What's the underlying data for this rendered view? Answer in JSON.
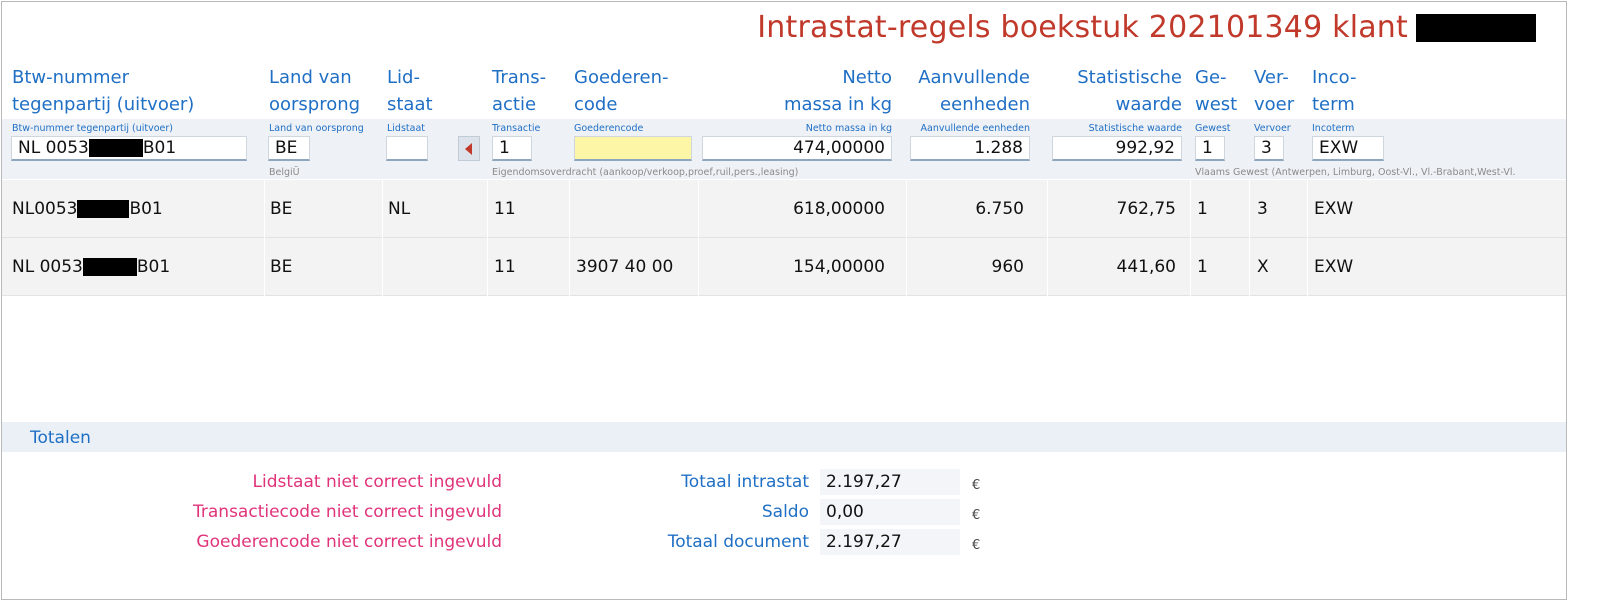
{
  "title": "Intrastat-regels boekstuk 202101349  klant",
  "headers": {
    "btw": "Btw-nummer\ntegenpartij (uitvoer)",
    "land": "Land van\noorsprong",
    "lid": "Lid-\nstaat",
    "trans": "Trans-\nactie",
    "goed": "Goederen-\ncode",
    "netto": "Netto\nmassa in kg",
    "aanv": "Aanvullende\neenheden",
    "stat": "Statistische\nwaarde",
    "gewest": "Ge-\nwest",
    "vervoer": "Ver-\nvoer",
    "inco": "Inco-\nterm"
  },
  "edit": {
    "labels": {
      "btw": "Btw-nummer tegenpartij (uitvoer)",
      "land": "Land van oorsprong",
      "lid": "Lidstaat",
      "trans": "Transactie",
      "goed": "Goederencode",
      "netto": "Netto massa in kg",
      "aanv": "Aanvullende eenheden",
      "stat": "Statistische waarde",
      "gewest": "Gewest",
      "vervoer": "Vervoer",
      "inco": "Incoterm"
    },
    "values": {
      "btw_prefix": "NL 0053",
      "btw_suffix": "B01",
      "land": "BE",
      "lid": "",
      "trans": "1",
      "goed": "",
      "netto": "474,00000",
      "aanv": "1.288",
      "stat": "992,92",
      "gewest": "1",
      "vervoer": "3",
      "inco": "EXW"
    },
    "hints": {
      "land": "BelgiÜ",
      "trans": "Eigendomsoverdracht (aankoop/verkoop,proef,ruil,pers.,leasing)",
      "gewest": "Vlaams Gewest (Antwerpen, Limburg, Oost-Vl., Vl.-Brabant,West-Vl."
    }
  },
  "rows": [
    {
      "btw_prefix": "NL0053",
      "btw_suffix": "B01",
      "land": "BE",
      "lid": "NL",
      "trans": "11",
      "goed": "",
      "netto": "618,00000",
      "aanv": "6.750",
      "stat": "762,75",
      "gewest": "1",
      "vervoer": "3",
      "inco": "EXW"
    },
    {
      "btw_prefix": "NL 0053",
      "btw_suffix": "B01",
      "land": "BE",
      "lid": "",
      "trans": "11",
      "goed": "3907 40 00",
      "netto": "154,00000",
      "aanv": "960",
      "stat": "441,60",
      "gewest": "1",
      "vervoer": "X",
      "inco": "EXW"
    }
  ],
  "totals": {
    "title": "Totalen",
    "errors": [
      "Lidstaat niet correct ingevuld",
      "Transactiecode niet correct ingevuld",
      "Goederencode niet correct ingevuld"
    ],
    "lines": [
      {
        "label": "Totaal intrastat",
        "value": "2.197,27",
        "currency": "€"
      },
      {
        "label": "Saldo",
        "value": "0,00",
        "currency": "€"
      },
      {
        "label": "Totaal document",
        "value": "2.197,27",
        "currency": "€"
      }
    ]
  },
  "colors": {
    "title": "#c0392b",
    "header": "#1f6fc5",
    "error": "#e0337a",
    "highlight": "#fdf6a6"
  }
}
